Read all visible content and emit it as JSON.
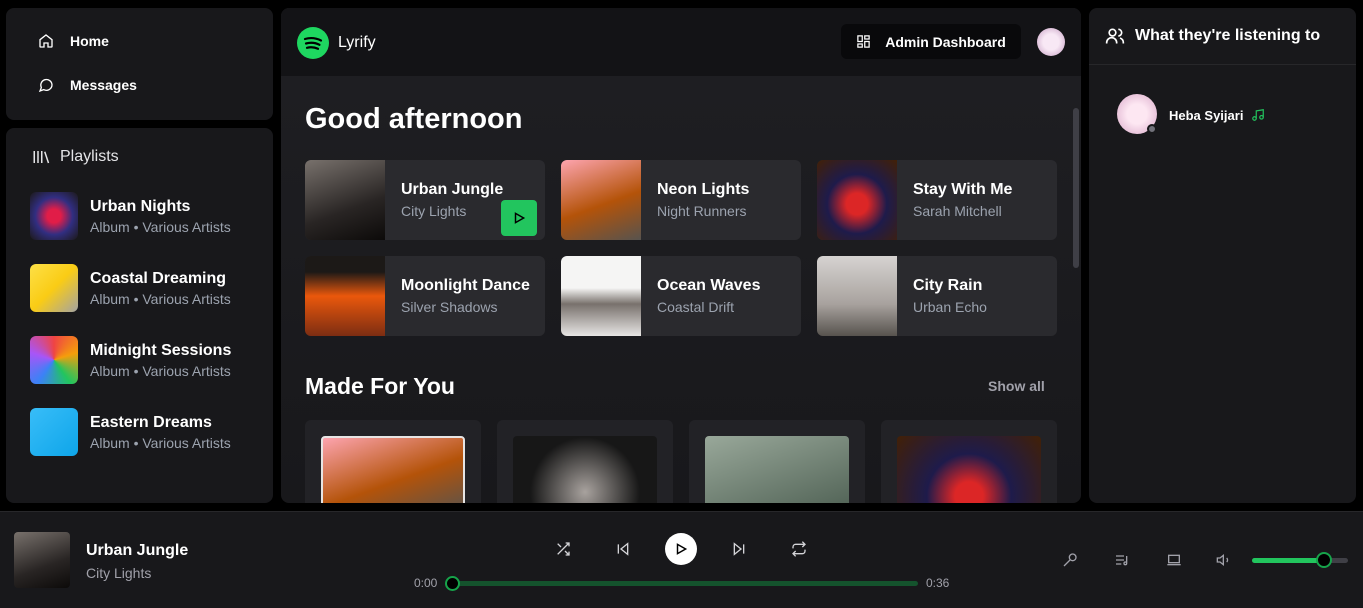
{
  "nav": {
    "home": "Home",
    "messages": "Messages"
  },
  "playlists": {
    "header": "Playlists",
    "items": [
      {
        "title": "Urban Nights",
        "subtitle": "Album • Various Artists"
      },
      {
        "title": "Coastal Dreaming",
        "subtitle": "Album • Various Artists"
      },
      {
        "title": "Midnight Sessions",
        "subtitle": "Album • Various Artists"
      },
      {
        "title": "Eastern Dreams",
        "subtitle": "Album • Various Artists"
      }
    ]
  },
  "topbar": {
    "app_name": "Lyrify",
    "admin_label": "Admin Dashboard"
  },
  "main": {
    "greeting": "Good afternoon",
    "featured": [
      {
        "title": "Urban Jungle",
        "artist": "City Lights"
      },
      {
        "title": "Neon Lights",
        "artist": "Night Runners"
      },
      {
        "title": "Stay With Me",
        "artist": "Sarah Mitchell"
      },
      {
        "title": "Moonlight Dance",
        "artist": "Silver Shadows"
      },
      {
        "title": "Ocean Waves",
        "artist": "Coastal Drift"
      },
      {
        "title": "City Rain",
        "artist": "Urban Echo"
      }
    ],
    "made_for_you": {
      "title": "Made For You",
      "show_all": "Show all"
    }
  },
  "friends": {
    "header": "What they're listening to",
    "items": [
      {
        "name": "Heba Syijari"
      }
    ]
  },
  "player": {
    "title": "Urban Jungle",
    "artist": "City Lights",
    "current_time": "0:00",
    "duration": "0:36",
    "progress": 0,
    "volume": 0.75
  },
  "colors": {
    "accent": "#22c55e",
    "panel": "#18181b",
    "background": "#000000"
  }
}
